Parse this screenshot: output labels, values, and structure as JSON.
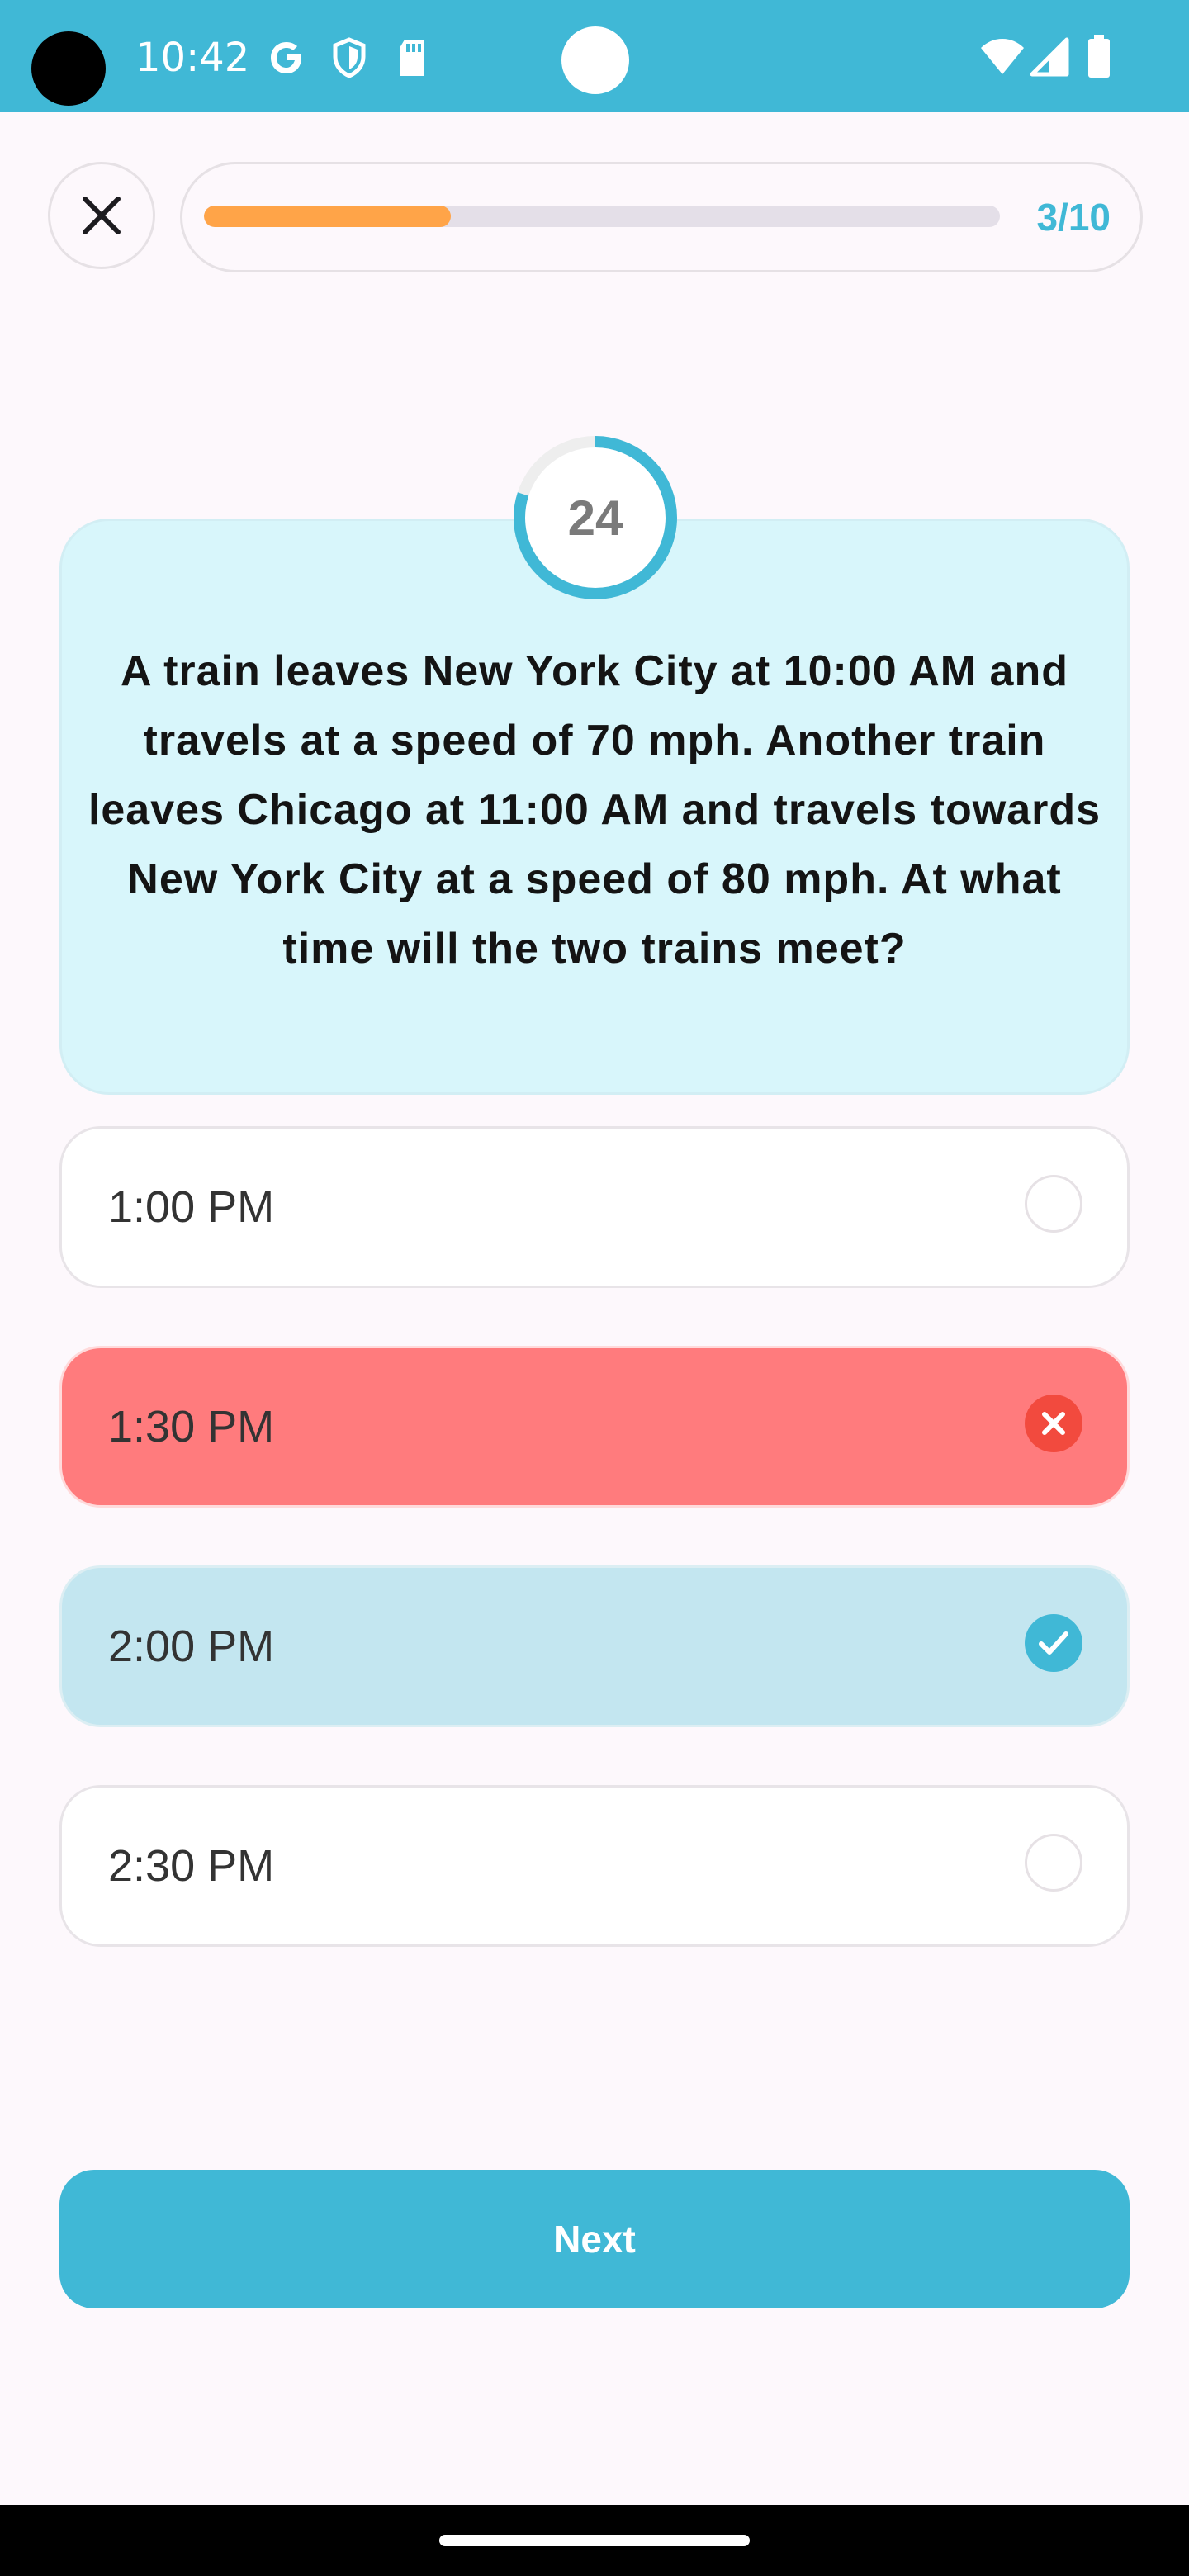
{
  "status_bar": {
    "time": "10:42",
    "left_icons": [
      "google-g-icon",
      "shield-icon",
      "sd-card-icon"
    ],
    "right_icons": [
      "wifi-icon",
      "cellular-signal-icon",
      "battery-icon"
    ]
  },
  "quiz": {
    "progress_text": "3/10",
    "progress_fraction": 0.31,
    "timer_value": "24",
    "timer_fraction": 0.8,
    "question": "A train leaves New York City at 10:00 AM and travels at a speed of 70 mph. Another train leaves Chicago at 11:00 AM and travels towards New York City at a speed of 80 mph. At what time will the two trains meet?",
    "options": [
      {
        "label": "1:00 PM",
        "state": "unselected"
      },
      {
        "label": "1:30 PM",
        "state": "wrong"
      },
      {
        "label": "2:00 PM",
        "state": "correct"
      },
      {
        "label": "2:30 PM",
        "state": "unselected"
      }
    ],
    "next_label": "Next"
  },
  "colors": {
    "accent": "#40b8d6",
    "progress": "#ffa448",
    "wrong": "#ff7b7d",
    "correct": "#c3e6f0",
    "card": "#d8f6fb"
  }
}
